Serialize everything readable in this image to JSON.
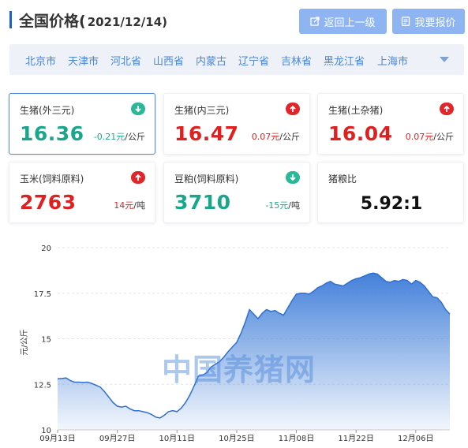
{
  "header": {
    "title": "全国价格(",
    "date": "2021/12/14)",
    "back_label": "返回上一级",
    "quote_label": "我要报价"
  },
  "regions": [
    "北京市",
    "天津市",
    "河北省",
    "山西省",
    "内蒙古",
    "辽宁省",
    "吉林省",
    "黑龙江省",
    "上海市"
  ],
  "cards": [
    {
      "label": "生猪(外三元)",
      "price": "16.36",
      "change": "-0.21元",
      "unit": "/公斤",
      "trend": "down",
      "active": true
    },
    {
      "label": "生猪(内三元)",
      "price": "16.47",
      "change": "0.07元",
      "unit": "/公斤",
      "trend": "up",
      "active": false
    },
    {
      "label": "生猪(土杂猪)",
      "price": "16.04",
      "change": "0.07元",
      "unit": "/公斤",
      "trend": "up",
      "active": false
    },
    {
      "label": "玉米(饲料原料)",
      "price": "2763",
      "change": "14元",
      "unit": "/吨",
      "trend": "up",
      "active": false
    },
    {
      "label": "豆粕(饲料原料)",
      "price": "3710",
      "change": "-15元",
      "unit": "/吨",
      "trend": "down",
      "active": false
    }
  ],
  "ratio": {
    "label": "猪粮比",
    "value": "5.92:1"
  },
  "watermark": "中国养猪网",
  "colors": {
    "up": "#e02020",
    "down": "#1aa68a",
    "accent": "#4a86d8",
    "button": "#8fb4f2",
    "line": "#3a7ad8"
  },
  "chart_data": {
    "type": "area",
    "ylabel": "元/公斤",
    "ylim": [
      10,
      20
    ],
    "yticks": [
      "10",
      "12.5",
      "15",
      "17.5",
      "20"
    ],
    "xticks": [
      "09月13日",
      "09月27日",
      "10月11日",
      "10月25日",
      "11月08日",
      "11月22日",
      "12月06日"
    ],
    "x": [
      "09-13",
      "09-14",
      "09-15",
      "09-16",
      "09-17",
      "09-18",
      "09-19",
      "09-20",
      "09-21",
      "09-22",
      "09-23",
      "09-24",
      "09-25",
      "09-26",
      "09-27",
      "09-28",
      "09-29",
      "09-30",
      "10-01",
      "10-02",
      "10-03",
      "10-04",
      "10-05",
      "10-06",
      "10-07",
      "10-08",
      "10-09",
      "10-10",
      "10-11",
      "10-12",
      "10-13",
      "10-14",
      "10-15",
      "10-16",
      "10-17",
      "10-18",
      "10-19",
      "10-20",
      "10-21",
      "10-22",
      "10-23",
      "10-24",
      "10-25",
      "10-26",
      "10-27",
      "10-28",
      "10-29",
      "10-30",
      "10-31",
      "11-01",
      "11-02",
      "11-03",
      "11-04",
      "11-05",
      "11-06",
      "11-07",
      "11-08",
      "11-09",
      "11-10",
      "11-11",
      "11-12",
      "11-13",
      "11-14",
      "11-15",
      "11-16",
      "11-17",
      "11-18",
      "11-19",
      "11-20",
      "11-21",
      "11-22",
      "11-23",
      "11-24",
      "11-25",
      "11-26",
      "11-27",
      "11-28",
      "11-29",
      "11-30",
      "12-01",
      "12-02",
      "12-03",
      "12-04",
      "12-05",
      "12-06",
      "12-07",
      "12-08",
      "12-09",
      "12-10",
      "12-11",
      "12-12",
      "12-13",
      "12-14"
    ],
    "series": [
      {
        "values": [
          12.8,
          12.82,
          12.85,
          12.7,
          12.62,
          12.62,
          12.6,
          12.62,
          12.55,
          12.45,
          12.35,
          12.1,
          11.8,
          11.5,
          11.3,
          11.25,
          11.3,
          11.15,
          11.05,
          11.05,
          11.0,
          10.95,
          10.85,
          10.7,
          10.65,
          10.8,
          11.0,
          11.05,
          11.0,
          11.2,
          11.5,
          11.9,
          12.4,
          12.95,
          13.0,
          13.15,
          13.45,
          13.6,
          13.75,
          14.0,
          14.3,
          14.55,
          14.8,
          15.3,
          15.9,
          16.6,
          16.35,
          16.1,
          16.4,
          16.6,
          16.5,
          16.55,
          16.4,
          16.3,
          16.7,
          17.1,
          17.45,
          17.5,
          17.5,
          17.45,
          17.6,
          17.8,
          17.9,
          18.05,
          18.15,
          18.0,
          17.95,
          17.9,
          18.05,
          18.2,
          18.3,
          18.35,
          18.45,
          18.55,
          18.6,
          18.55,
          18.35,
          18.15,
          18.1,
          18.2,
          18.15,
          18.25,
          18.2,
          18.0,
          18.2,
          18.1,
          17.9,
          17.6,
          17.3,
          17.25,
          17.0,
          16.6,
          16.36
        ]
      }
    ]
  }
}
